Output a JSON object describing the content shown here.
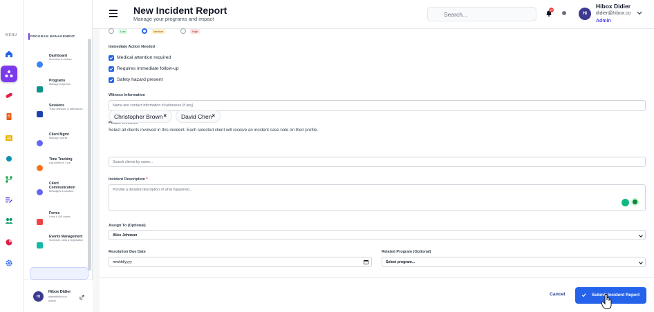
{
  "header": {
    "title": "New Incident Report",
    "subtitle": "Manage your programs and impact",
    "search_placeholder": "Search...",
    "notification_count": "10",
    "user": {
      "initials": "HI",
      "name": "Hibox Didier",
      "email": "didier@hibox.co",
      "role": "Admin"
    }
  },
  "rail": {
    "menu_label": "MENU"
  },
  "sidebar": {
    "section_title": "PROGRAM MANAGEMENT",
    "items": [
      {
        "title": "Dashboard",
        "sub": "Overview & metrics",
        "color": "#3b82f6"
      },
      {
        "title": "Programs",
        "sub": "Manage programs",
        "color": "#0d9488"
      },
      {
        "title": "Sessions",
        "sub": "Track sessions & attendance",
        "color": "#1e40af"
      },
      {
        "title": "Client Mgmt",
        "sub": "Manage Clients",
        "color": "#6366f1"
      },
      {
        "title": "Time Tracking",
        "sub": "Log clients in / out",
        "color": "#f97316"
      },
      {
        "title": "Client Communication",
        "sub": "Messages & updates",
        "color": "#6366f1"
      },
      {
        "title": "Forms",
        "sub": "Links & QR codes",
        "color": "#ef4444"
      },
      {
        "title": "Events Management",
        "sub": "Schedule, slots & registration",
        "color": "#14b8a6"
      }
    ],
    "footer": {
      "initials": "HI",
      "name": "Hibox Didier",
      "email": "didier@hibox.co",
      "role": "Admin"
    }
  },
  "form": {
    "severity": {
      "options": [
        "Low",
        "Medium",
        "High"
      ],
      "selected": "Medium"
    },
    "immediate_action": {
      "label": "Immediate Action Needed",
      "items": [
        "Medical attention required",
        "Requires immediate follow-up",
        "Safety hazard present"
      ]
    },
    "witness": {
      "label": "Witness Information",
      "placeholder": "Name and contact information of witnesses (if any)"
    },
    "people": {
      "label": "People Involved",
      "help": "Select all clients involved in this incident. Each selected client will receive an incident case note on their profile.",
      "chips": [
        "Christopher Brown",
        "David Chen"
      ],
      "search_placeholder": "Search clients by name..."
    },
    "description": {
      "label": "Incident Description",
      "required_mark": "*",
      "placeholder": "Provide a detailed description of what happened..."
    },
    "assign": {
      "label": "Assign To (Optional)",
      "value": "Alice Johnson"
    },
    "due_date": {
      "label": "Resolution Due Date",
      "value": "mm/dd/yyyy"
    },
    "related_program": {
      "label": "Related Program (Optional)",
      "value": "Select program..."
    }
  },
  "actions": {
    "cancel": "Cancel",
    "submit": "Submit Incident Report"
  },
  "colors": {
    "accent": "#2563eb",
    "brand_purple": "#7c3aed"
  }
}
